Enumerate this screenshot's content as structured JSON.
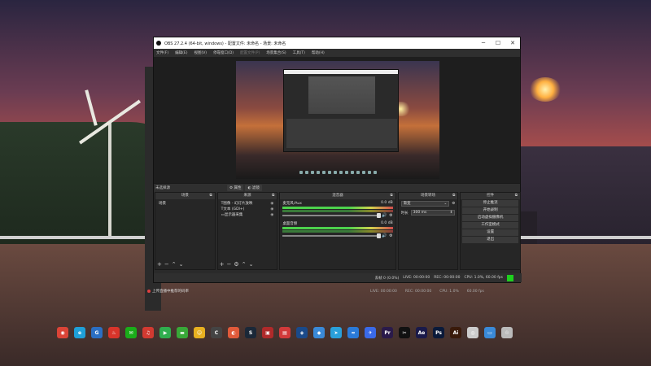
{
  "window": {
    "title": "OBS 27.2.4 (64-bit, windows) - 配置文件: 未命名 - 场景: 未命名",
    "buttons": {
      "minimize": "─",
      "maximize": "☐",
      "close": "✕"
    }
  },
  "menu": [
    "文件(F)",
    "编辑(E)",
    "视图(V)",
    "停靠窗口(D)",
    "配置文件(P)",
    "场景集合(S)",
    "工具(T)",
    "帮助(H)"
  ],
  "midbar": {
    "no_source": "未选择源",
    "properties": "属性",
    "filters": "滤镜"
  },
  "docks": {
    "scenes": {
      "header": "场景",
      "items": [
        "场景"
      ]
    },
    "sources": {
      "header": "来源",
      "items": [
        "图像 - 幻灯片放映",
        "文本 (GDI+)",
        "显示器采集"
      ]
    },
    "mixer": {
      "header": "混音器",
      "channels": [
        {
          "name": "麦克风/Aux",
          "level": "0.0 dB"
        },
        {
          "name": "桌面音频",
          "level": "0.0 dB"
        }
      ]
    },
    "transitions": {
      "header": "场景转场",
      "selected": "渐变",
      "duration_label": "时长",
      "duration_value": "300 ms"
    },
    "controls": {
      "header": "控件",
      "buttons": [
        "停止推流",
        "开始录制",
        "启动虚拟摄像机",
        "工作室模式",
        "设置",
        "退出"
      ]
    }
  },
  "status": {
    "dropped": "丢帧 0 (0.0%)",
    "live": "LIVE: 00:00:00",
    "rec": "REC: 00:00:00",
    "cpu": "CPU: 1.0%, 60.00 fps"
  },
  "notification": "上传直播中推荐的码率",
  "background_status": [
    "LIVE: 00:00:00",
    "REC: 00:00:00",
    "CPU: 1.0%",
    "60.00 fps"
  ],
  "taskbar": [
    {
      "name": "chrome",
      "color": "#db4437",
      "glyph": "◉"
    },
    {
      "name": "edge",
      "color": "#1fa0d8",
      "glyph": "e"
    },
    {
      "name": "app1",
      "color": "#2b6fc4",
      "glyph": "G"
    },
    {
      "name": "app2",
      "color": "#d8342a",
      "glyph": "♨"
    },
    {
      "name": "wechat",
      "color": "#1aad19",
      "glyph": "✉"
    },
    {
      "name": "netease",
      "color": "#d33a31",
      "glyph": "♫"
    },
    {
      "name": "play",
      "color": "#2fae4e",
      "glyph": "▶"
    },
    {
      "name": "app3",
      "color": "#38a838",
      "glyph": "▬"
    },
    {
      "name": "app4",
      "color": "#e8b020",
      "glyph": "☺"
    },
    {
      "name": "app5",
      "color": "#444",
      "glyph": "C"
    },
    {
      "name": "app6",
      "color": "#e05a3a",
      "glyph": "◐"
    },
    {
      "name": "steam",
      "color": "#1b2838",
      "glyph": "S"
    },
    {
      "name": "app7",
      "color": "#b02a2a",
      "glyph": "▣"
    },
    {
      "name": "app8",
      "color": "#d23a3a",
      "glyph": "▤"
    },
    {
      "name": "app9",
      "color": "#1a4a8a",
      "glyph": "◈"
    },
    {
      "name": "app10",
      "color": "#3a8ad8",
      "glyph": "◆"
    },
    {
      "name": "telegram",
      "color": "#2aa0da",
      "glyph": "➤"
    },
    {
      "name": "app11",
      "color": "#2a7ad8",
      "glyph": "≈"
    },
    {
      "name": "app12",
      "color": "#3a6ae8",
      "glyph": "✈"
    },
    {
      "name": "premiere",
      "color": "#2a1a4a",
      "glyph": "Pr"
    },
    {
      "name": "capcut",
      "color": "#111",
      "glyph": "✂"
    },
    {
      "name": "aftereffects",
      "color": "#1a1a4a",
      "glyph": "Ae"
    },
    {
      "name": "photoshop",
      "color": "#0a1a3a",
      "glyph": "Ps"
    },
    {
      "name": "illustrator",
      "color": "#3a1a0a",
      "glyph": "Ai"
    },
    {
      "name": "app13",
      "color": "#ccc",
      "glyph": "◎"
    },
    {
      "name": "app14",
      "color": "#3a8ad8",
      "glyph": "▭"
    },
    {
      "name": "recycle",
      "color": "#bbb",
      "glyph": "♲"
    }
  ]
}
